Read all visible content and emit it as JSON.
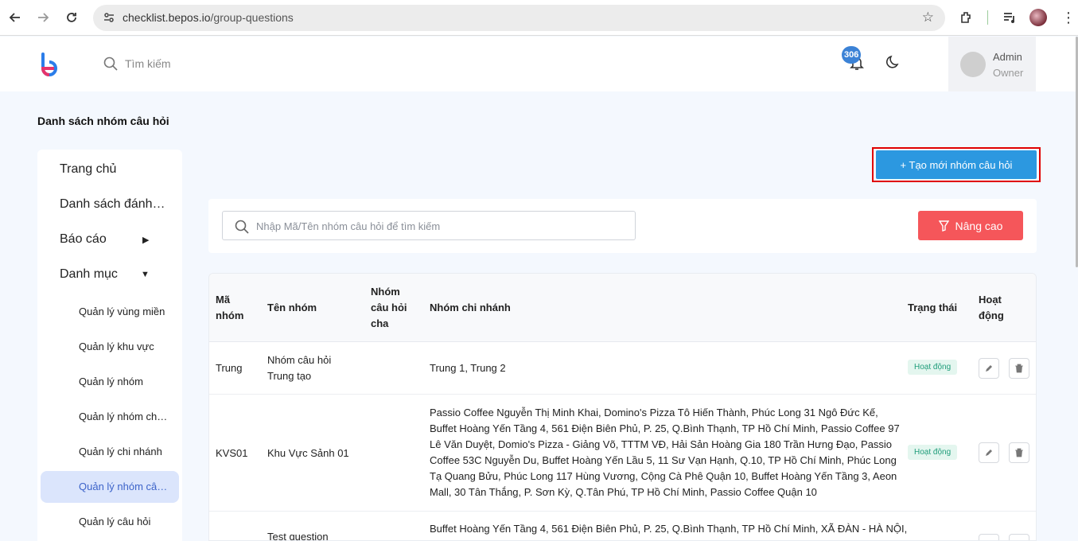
{
  "browser": {
    "url_host": "checklist.bepos.io",
    "url_path": "/group-questions"
  },
  "header": {
    "search_placeholder": "Tìm kiếm",
    "notification_count": "306",
    "user_name": "Admin",
    "user_role": "Owner"
  },
  "page": {
    "title": "Danh sách nhóm câu hỏi"
  },
  "sidebar": {
    "items": [
      {
        "label": "Trang chủ"
      },
      {
        "label": "Danh sách đánh giá"
      },
      {
        "label": "Báo cáo"
      },
      {
        "label": "Danh mục"
      }
    ],
    "subitems": [
      {
        "label": "Quản lý vùng miền"
      },
      {
        "label": "Quản lý khu vực"
      },
      {
        "label": "Quản lý nhóm"
      },
      {
        "label": "Quản lý nhóm chi nhánh"
      },
      {
        "label": "Quản lý chi nhánh"
      },
      {
        "label": "Quản lý nhóm câu hỏi"
      },
      {
        "label": "Quản lý câu hỏi"
      }
    ]
  },
  "toolbar": {
    "create_label": "+ Tạo mới nhóm câu hỏi",
    "search_placeholder": "Nhập Mã/Tên nhóm câu hỏi để tìm kiếm",
    "advanced_label": "Nâng cao"
  },
  "table": {
    "columns": {
      "code_l1": "Mã",
      "code_l2": "nhóm",
      "name": "Tên nhóm",
      "parent_l1": "Nhóm",
      "parent_l2": "câu hỏi",
      "parent_l3": "cha",
      "branch_group": "Nhóm chi nhánh",
      "status": "Trạng thái",
      "action_l1": "Hoạt",
      "action_l2": "động"
    },
    "rows": [
      {
        "code": "Trung",
        "name_l1": "Nhóm câu hỏi",
        "name_l2": "Trung tạo",
        "parent": "",
        "branches": [
          "Trung 1, Trung 2"
        ],
        "status": "Hoạt động"
      },
      {
        "code": "KVS01",
        "name_l1": "Khu Vực Sảnh 01",
        "name_l2": "",
        "parent": "",
        "branches": [
          "Passio Coffee Nguyễn Thị Minh Khai, Domino's Pizza Tô Hiến Thành, Phúc Long 31 Ngô Đức Kế,",
          "Buffet Hoàng Yến Tầng 4, 561 Điện Biên Phủ, P. 25, Q.Bình Thạnh, TP Hồ Chí Minh, Passio Coffee 97",
          "Lê Văn Duyệt, Domio's Pizza - Giảng Võ, TTTM VĐ, Hải Sản Hoàng Gia 180 Trần Hưng Đạo, Passio",
          "Coffee 53C Nguyễn Du, Buffet Hoàng Yến Lầu 5, 11 Sư Vạn Hạnh, Q.10, TP Hồ Chí Minh, Phúc Long",
          "Tạ Quang Bửu, Phúc Long 117 Hùng Vương, Cộng Cà Phê Quận 10, Buffet Hoàng Yến Tầng 3, Aeon",
          "Mall, 30 Tân Thắng, P. Sơn Kỳ, Q.Tân Phú, TP Hồ Chí Minh, Passio Coffee Quận 10"
        ],
        "status": "Hoạt động"
      },
      {
        "code": "",
        "name_l1": "Test question",
        "name_l2": "",
        "parent": "",
        "branches": [
          "Buffet Hoàng Yến Tầng 4, 561 Điện Biên Phủ, P. 25, Q.Bình Thạnh, TP Hồ Chí Minh, XÃ ĐÀN - HÀ NỘI,"
        ],
        "status": ""
      }
    ]
  },
  "colors": {
    "primary": "#2c98e0",
    "danger": "#f5565a",
    "active_bg": "#dbe5fc",
    "status_green": "#1f9d7a"
  }
}
